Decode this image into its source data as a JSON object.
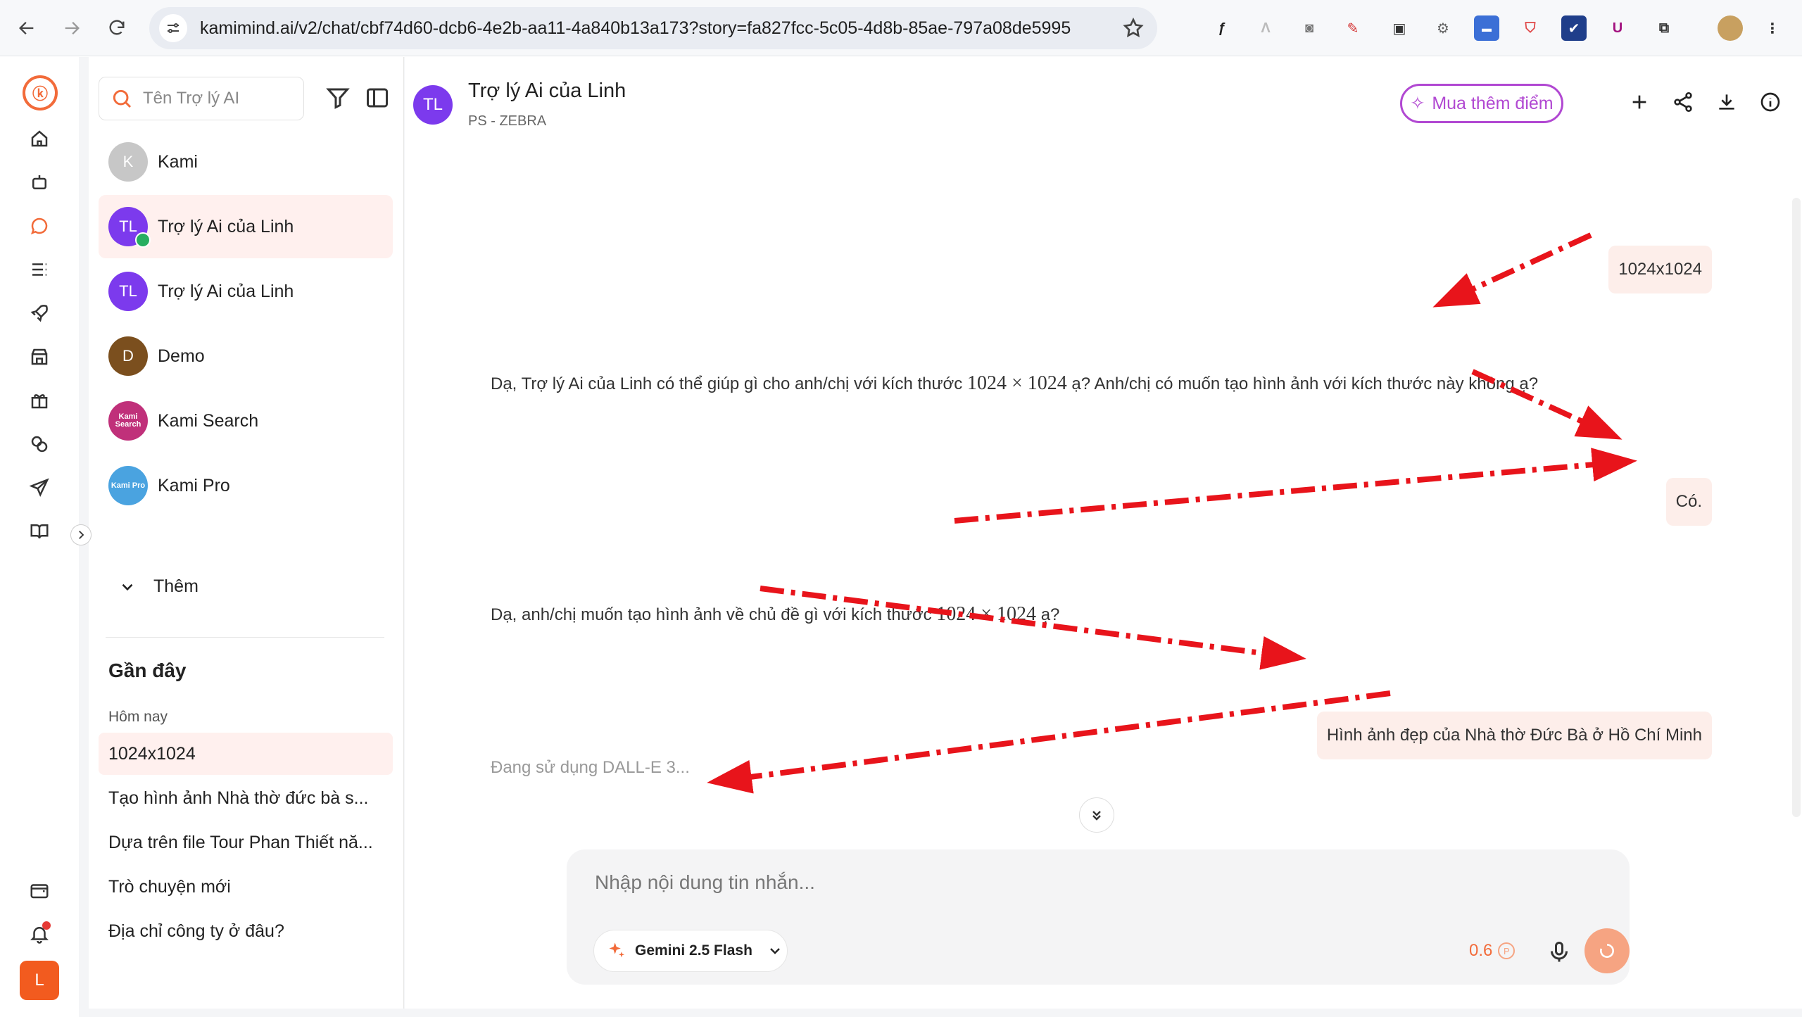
{
  "browser": {
    "url": "kamimind.ai/v2/chat/cbf74d60-dcb6-4e2b-aa11-4a840b13a173?story=fa827fcc-5c05-4d8b-85ae-797a08de5995"
  },
  "rail": {
    "active": "chat",
    "user_initial": "L"
  },
  "sidebar": {
    "search_placeholder": "Tên Trợ lý AI",
    "bots": [
      {
        "name": "Kami",
        "initials": "K",
        "color": "#c7c7c7"
      },
      {
        "name": "Trợ lý Ai của Linh",
        "initials": "TL",
        "color": "#7c3aed",
        "selected": true
      },
      {
        "name": "Trợ lý Ai của Linh",
        "initials": "TL",
        "color": "#7c3aed"
      },
      {
        "name": "Demo",
        "initials": "D",
        "color": "#7b4f1e"
      },
      {
        "name": "Kami Search",
        "initials": "Kami Search",
        "color": "#c0307a"
      },
      {
        "name": "Kami Pro",
        "initials": "Kami Pro",
        "color": "#4aa3e0"
      }
    ],
    "more_label": "Thêm",
    "recent_title": "Gần đây",
    "today_label": "Hôm nay",
    "recent": [
      "1024x1024",
      "Tạo hình ảnh Nhà thờ đức bà s...",
      "Dựa trên file Tour Phan Thiết nă...",
      "Trò chuyện mới",
      "Địa chỉ công ty ở đâu?"
    ]
  },
  "header": {
    "avatar_initials": "TL",
    "title": "Trợ lý Ai của Linh",
    "subtitle": "PS - ZEBRA",
    "buy_label": "Mua thêm điểm"
  },
  "chat": {
    "messages": [
      {
        "role": "user",
        "text": "1024x1024"
      },
      {
        "role": "bot",
        "pre": "Dạ, Trợ lý Ai của Linh có thể giúp gì cho anh/chị với kích thước ",
        "math": "1024 × 1024",
        "post": " ạ? Anh/chị có muốn tạo hình ảnh với kích thước này không ạ?"
      },
      {
        "role": "user",
        "text": "Có."
      },
      {
        "role": "bot",
        "pre": "Dạ, anh/chị muốn tạo hình ảnh về chủ đề gì với kích thước ",
        "math": "1024 × 1024",
        "post": " ạ?"
      },
      {
        "role": "user",
        "text": "Hình ảnh đẹp của Nhà thờ Đức Bà ở Hồ Chí Minh"
      }
    ],
    "status": "Đang sử dụng DALL-E 3..."
  },
  "composer": {
    "placeholder": "Nhập nội dung tin nhắn...",
    "model": "Gemini 2.5 Flash",
    "cost": "0.6",
    "cost_unit": "P"
  },
  "annotation_color": "#e8141b"
}
